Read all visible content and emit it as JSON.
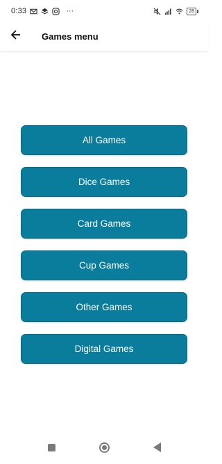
{
  "status_bar": {
    "time": "0:33",
    "battery": "28",
    "left_icons": [
      "mail-icon",
      "layers-icon",
      "instagram-icon",
      "more-dots-icon"
    ],
    "right_icons": [
      "mute-icon",
      "signal-icon",
      "wifi-icon",
      "battery-icon"
    ],
    "more": "···"
  },
  "app_bar": {
    "title": "Games menu",
    "back_icon": "arrow-left-icon"
  },
  "menu": {
    "items": [
      {
        "label": "All Games"
      },
      {
        "label": "Dice Games"
      },
      {
        "label": "Card Games"
      },
      {
        "label": "Cup Games"
      },
      {
        "label": "Other Games"
      },
      {
        "label": "Digital Games"
      }
    ],
    "button_color": "#0a7d9d"
  },
  "nav_bar": {
    "buttons": [
      "recents-square-icon",
      "home-circle-icon",
      "back-triangle-icon"
    ]
  }
}
